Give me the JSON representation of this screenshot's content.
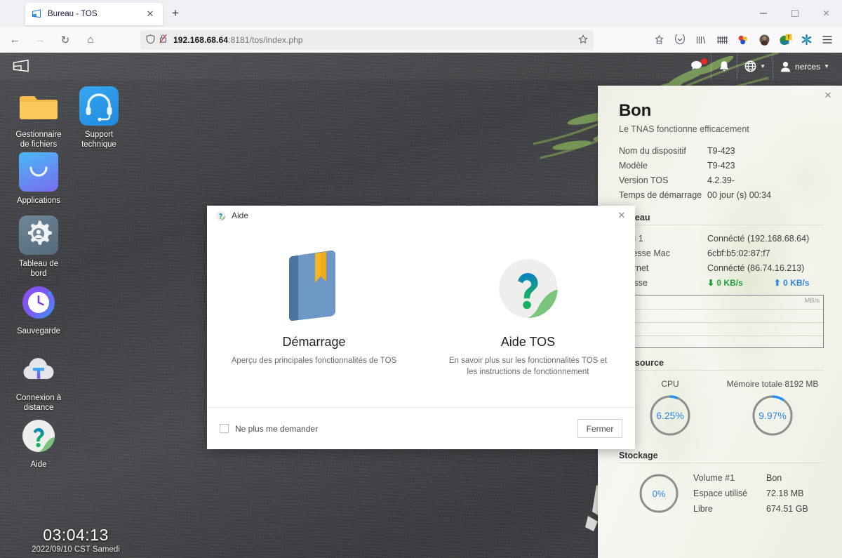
{
  "browser": {
    "tab": {
      "title": "Bureau - TOS",
      "favicon_icon": "tos-logo-icon",
      "close_icon": "close-icon"
    },
    "new_tab_label": "+",
    "window_controls": {
      "minimize": "minimize-icon",
      "maximize": "maximize-icon",
      "close": "close-icon"
    },
    "nav": {
      "back": "back-arrow-icon",
      "forward": "forward-arrow-icon",
      "reload": "reload-icon",
      "home": "home-icon"
    },
    "url": {
      "host": "192.168.68.64",
      "rest": ":8181/tos/index.php",
      "shield_icon": "shield-icon",
      "lock_slash_icon": "lock-slash-icon",
      "bookmark_icon": "star-icon"
    },
    "extensions": [
      {
        "name": "save-to-pocket-icon",
        "glyph": "☆"
      },
      {
        "name": "pocket-icon",
        "glyph": "♡"
      },
      {
        "name": "library-icon",
        "glyph": "|||\\"
      },
      {
        "name": "bookmarks-toolbar-icon",
        "glyph": "####"
      },
      {
        "name": "colorful-extension-icon",
        "glyph": ""
      },
      {
        "name": "avatar-extension-icon",
        "glyph": ""
      },
      {
        "name": "warning-extension-icon",
        "glyph": "!"
      },
      {
        "name": "puzzle-extension-icon",
        "glyph": ""
      },
      {
        "name": "app-menu-icon",
        "glyph": "≡"
      }
    ]
  },
  "tos": {
    "logo_icon": "tos-logo-icon",
    "topbar": [
      {
        "name": "messages-icon",
        "has_badge": true
      },
      {
        "name": "notifications-bell-icon",
        "has_badge": false
      },
      {
        "name": "language-globe-icon",
        "has_caret": true
      },
      {
        "name": "user-menu",
        "label": "nerces",
        "has_caret": true
      }
    ],
    "desktop_icons": [
      {
        "name": "gestionnaire-de-fichiers",
        "label": "Gestionnaire\nde fichiers",
        "icon": "folder-icon"
      },
      {
        "name": "support-technique",
        "label": "Support\ntechnique",
        "icon": "headset-icon"
      },
      {
        "name": "applications",
        "label": "Applications",
        "icon": "shopping-bag-icon"
      },
      {
        "name": "tableau-de-bord",
        "label": "Tableau de\nbord",
        "icon": "gear-icon"
      },
      {
        "name": "sauvegarde",
        "label": "Sauvegarde",
        "icon": "clock-backup-icon"
      },
      {
        "name": "connexion-a-distance",
        "label": "Connexion à\ndistance",
        "icon": "cloud-t-icon"
      },
      {
        "name": "aide",
        "label": "Aide",
        "icon": "question-mark-icon"
      }
    ],
    "clock": {
      "time": "03:04:13",
      "date": "2022/09/10 CST Samedi"
    }
  },
  "status_panel": {
    "close_icon": "close-icon",
    "title": "Bon",
    "subtitle": "Le TNAS fonctionne efficacement",
    "device_info": [
      {
        "key": "Nom du dispositif",
        "value": "T9-423"
      },
      {
        "key": "Modèle",
        "value": "T9-423"
      },
      {
        "key": "Version TOS",
        "value": "4.2.39-"
      },
      {
        "key": "Temps de démarrage",
        "value": "00 jour (s) 00:34"
      }
    ],
    "network": {
      "heading": "Réseau",
      "rows": [
        {
          "key": "LAN 1",
          "value": "Connécté (192.168.68.64)"
        },
        {
          "key": "Adresse Mac",
          "value": "6cbf:b5:02:87:f7"
        },
        {
          "key": "Internet",
          "value": "Connécté (86.74.16.213)"
        }
      ],
      "speed_label": "Vitesse",
      "download": "0 KB/s",
      "upload": "0 KB/s",
      "graph_unit": "MB/s"
    },
    "resource": {
      "heading": "Ressource",
      "cpu": {
        "label": "CPU",
        "value": "6.25%",
        "percent": 6.25
      },
      "memory": {
        "label": "Mémoire totale 8192 MB",
        "value": "9.97%",
        "percent": 9.97
      }
    },
    "storage": {
      "heading": "Stockage",
      "percent_label": "0%",
      "percent": 0,
      "rows": [
        {
          "key": "Volume #1",
          "value": "Bon"
        },
        {
          "key": "Espace utilisé",
          "value": "72.18 MB"
        },
        {
          "key": "Libre",
          "value": "674.51 GB"
        }
      ]
    },
    "colors": {
      "accent": "#2f86e0",
      "download": "#21a33c",
      "upload": "#2f86e0"
    }
  },
  "aide_dialog": {
    "title": "Aide",
    "title_icon": "question-mark-icon",
    "close_icon": "close-icon",
    "choices": [
      {
        "name": "demarrage",
        "title": "Démarrage",
        "desc": "Aperçu des principales fonctionnalités de TOS",
        "icon": "book-icon"
      },
      {
        "name": "aide-tos",
        "title": "Aide TOS",
        "desc": "En savoir plus sur les fonctionnalités TOS et les instructions de fonctionnement",
        "icon": "question-mark-icon"
      }
    ],
    "checkbox_label": "Ne plus me demander",
    "close_button": "Fermer"
  }
}
